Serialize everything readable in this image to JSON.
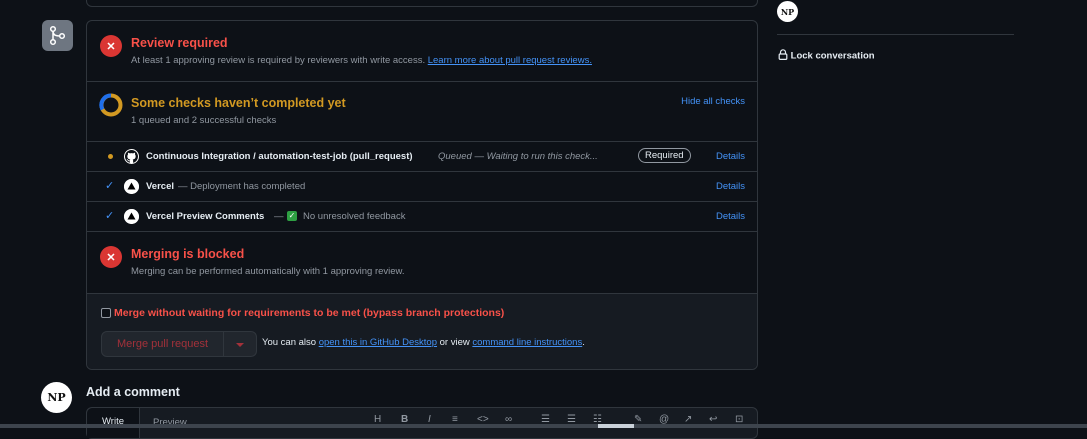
{
  "review": {
    "title": "Review required",
    "desc": "At least 1 approving review is required by reviewers with write access.",
    "link": "Learn more about pull request reviews.",
    "icon": "x-icon"
  },
  "checks": {
    "title": "Some checks haven’t completed yet",
    "subtitle": "1 queued and 2 successful checks",
    "toggle": "Hide all checks",
    "rows": [
      {
        "name": "Continuous Integration / automation-test-job (pull_request)",
        "status": "Queued — Waiting to run this check...",
        "badge": "Required",
        "details": "Details",
        "icon": "github-icon"
      },
      {
        "name": "Vercel",
        "status": "— Deployment has completed",
        "details": "Details",
        "icon": "vercel-icon"
      },
      {
        "name": "Vercel Preview Comments",
        "status_prefix": "—",
        "status": "No unresolved feedback",
        "details": "Details",
        "icon": "vercel-icon"
      }
    ]
  },
  "blocked": {
    "title": "Merging is blocked",
    "desc": "Merging can be performed automatically with 1 approving review."
  },
  "bypass": {
    "label": "Merge without waiting for requirements to be met (bypass branch protections)"
  },
  "merge": {
    "button": "Merge pull request",
    "also_prefix": "You can also",
    "desktop_link": "open this in GitHub Desktop",
    "or_view": "or view",
    "cli_link": "command line instructions",
    "period": "."
  },
  "comment": {
    "heading": "Add a comment",
    "tab_write": "Write",
    "tab_preview": "Preview"
  },
  "sidebar": {
    "lock_label": "Lock conversation"
  },
  "avatar": {
    "initials": "NP"
  },
  "colors": {
    "danger": "#da3633",
    "attention": "#d29922",
    "accent": "#4493f8"
  }
}
